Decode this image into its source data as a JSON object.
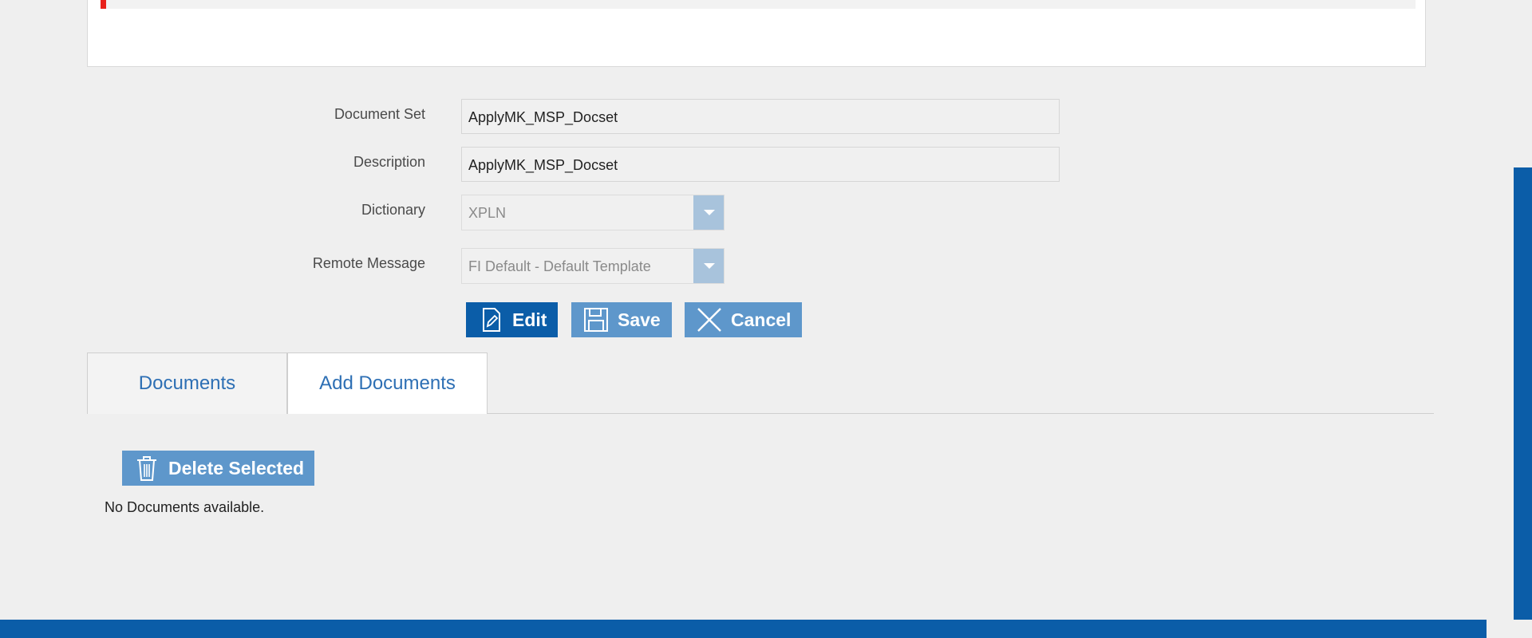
{
  "form": {
    "document_set": {
      "label": "Document Set",
      "value": "ApplyMK_MSP_Docset"
    },
    "description": {
      "label": "Description",
      "value": "ApplyMK_MSP_Docset"
    },
    "dictionary": {
      "label": "Dictionary",
      "value": "XPLN"
    },
    "remote_message": {
      "label": "Remote Message",
      "value": "FI Default - Default Template"
    }
  },
  "actions": {
    "edit_label": "Edit",
    "save_label": "Save",
    "cancel_label": "Cancel"
  },
  "tabs": [
    {
      "label": "Documents",
      "active": true
    },
    {
      "label": "Add Documents",
      "active": false
    }
  ],
  "documents": {
    "delete_selected_label": "Delete Selected",
    "empty_message": "No Documents available."
  },
  "colors": {
    "primary": "#0b5da8",
    "button_light": "#5e97cb",
    "tab_text": "#2d6fb4",
    "alert_marker": "#e8211b"
  }
}
